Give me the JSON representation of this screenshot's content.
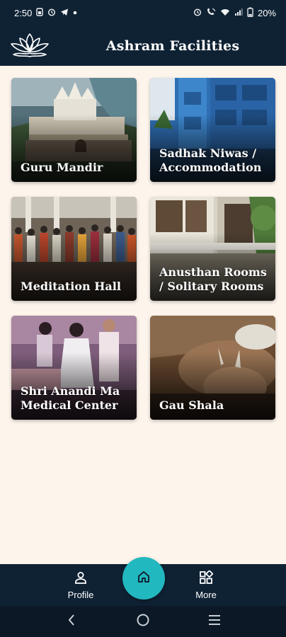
{
  "status_bar": {
    "time": "2:50",
    "battery": "20%",
    "left_icons": [
      "sim-icon",
      "alarm-icon",
      "telegram-icon",
      "dot-icon"
    ],
    "right_icons": [
      "alarm-icon",
      "wifi-calling-icon",
      "wifi-icon",
      "signal-icon",
      "battery-icon"
    ]
  },
  "header": {
    "title": "Ashram Facilities",
    "logo": "lotus-logo"
  },
  "facilities": [
    {
      "label": "Guru Mandir",
      "photo": "temple-photo"
    },
    {
      "label": "Sadhak Niwas / Accommodation",
      "photo": "blue-building-photo"
    },
    {
      "label": "Meditation Hall",
      "photo": "crowd-photo"
    },
    {
      "label": "Anusthan Rooms / Solitary Rooms",
      "photo": "rooms-building-photo"
    },
    {
      "label": "Shri Anandi Ma Medical Center",
      "photo": "medical-photo"
    },
    {
      "label": "Gau Shala",
      "photo": "cow-photo"
    }
  ],
  "bottom_nav": {
    "profile_label": "Profile",
    "more_label": "More",
    "home_icon": "home-icon"
  },
  "colors": {
    "header_bg": "#0f2234",
    "page_bg": "#fdf5ec",
    "accent": "#22b8bf"
  }
}
